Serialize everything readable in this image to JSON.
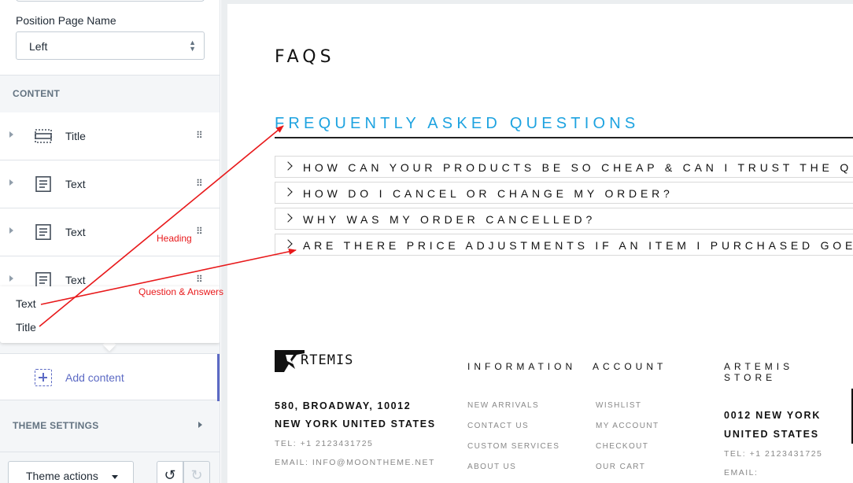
{
  "sidebar": {
    "position_field": {
      "label": "Position Page Name",
      "value": "Left"
    },
    "content_section": "CONTENT",
    "items": [
      {
        "label": "Title",
        "icon": "title-block-icon"
      },
      {
        "label": "Text",
        "icon": "text-block-icon"
      },
      {
        "label": "Text",
        "icon": "text-block-icon"
      },
      {
        "label": "Text",
        "icon": "text-block-icon"
      }
    ],
    "popover_options": [
      "Text",
      "Title"
    ],
    "add_content": "Add content",
    "theme_settings": "THEME SETTINGS",
    "theme_actions": "Theme actions"
  },
  "preview": {
    "page_title": "FAQS",
    "heading": "FREQUENTLY ASKED QUESTIONS",
    "questions": [
      "HOW CAN YOUR PRODUCTS BE SO CHEAP & CAN I TRUST THE QU",
      "HOW DO I CANCEL OR CHANGE MY ORDER?",
      "WHY WAS MY ORDER CANCELLED?",
      "ARE THERE PRICE ADJUSTMENTS IF AN ITEM I PURCHASED GOES"
    ],
    "footer": {
      "logo_text": "RTEMIS",
      "address": [
        "580, BROADWAY, 10012",
        "NEW YORK UNITED STATES"
      ],
      "tel": "TEL: +1 2123431725",
      "email": "EMAIL: INFO@MOONTHEME.NET",
      "information": {
        "heading": "INFORMATION",
        "links": [
          "NEW ARRIVALS",
          "CONTACT US",
          "CUSTOM SERVICES",
          "ABOUT US"
        ]
      },
      "account": {
        "heading": "ACCOUNT",
        "links": [
          "WISHLIST",
          "MY ACCOUNT",
          "CHECKOUT",
          "OUR CART"
        ]
      },
      "store": {
        "heading": [
          "ARTEMIS",
          "STORE"
        ],
        "lines": [
          "0012 NEW YORK",
          "UNITED STATES"
        ],
        "tel": "TEL: +1 2123431725",
        "email": "EMAIL:"
      }
    }
  },
  "annotations": {
    "heading_label": "Heading",
    "qa_label": "Question & Answers",
    "color": "#e8191b"
  },
  "colors": {
    "accent": "#5c6ac4",
    "faq_heading": "#1ea3e0"
  }
}
